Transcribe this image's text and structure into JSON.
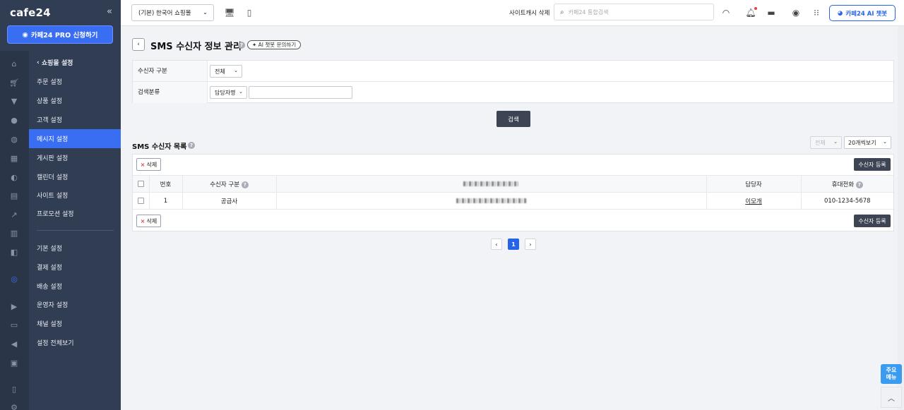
{
  "brand": {
    "logo": "cafe24",
    "collapse_icon": "«",
    "pro_button": "카페24 PRO 신청하기"
  },
  "sidebar": {
    "rail_icons": [
      "home-icon",
      "cart-icon",
      "shirt-icon",
      "person-icon",
      "chat-icon",
      "grid-icon",
      "palette-icon",
      "coupon-icon",
      "chart-icon",
      "calendar-icon",
      "app-icon",
      "medal-icon",
      "youtube-icon",
      "store-icon",
      "megaphone-icon",
      "shop-icon",
      "doc-icon",
      "settings-icon"
    ],
    "menu_head": "쇼핑몰 설정",
    "items": [
      "주문 설정",
      "상품 설정",
      "고객 설정",
      "메시지 설정",
      "게시판 설정",
      "캘린더 설정",
      "사이트 설정",
      "프로모션 설정"
    ],
    "items2": [
      "기본 설정",
      "결제 설정",
      "배송 설정",
      "운영자 설정",
      "채널 설정",
      "설정 전체보기"
    ]
  },
  "topbar": {
    "shop_select": "(기본) 한국어 쇼핑몰",
    "cache_label": "사이트캐시 삭제",
    "search_placeholder": "카페24 통합검색",
    "ai_chat": "카페24 AI 챗봇"
  },
  "page": {
    "title": "SMS 수신자 정보 관리",
    "ai_ask": "AI 챗봇 문의하기",
    "filter": {
      "recipient_type_label": "수신자 구분",
      "recipient_type_value": "전체",
      "search_category_label": "검색분류",
      "search_category_value": "담당자명",
      "search_text": ""
    },
    "search_button": "검색",
    "list_title": "SMS 수신자 목록",
    "select_all": "전체",
    "select_count": "20개씩보기",
    "delete_button": "삭제",
    "register_button": "수신자 등록",
    "table": {
      "headers": [
        "번호",
        "수신자 구분",
        "",
        "담당자",
        "휴대전화"
      ],
      "rows": [
        {
          "no": "1",
          "type": "공급사",
          "manager": "이모개",
          "phone": "010-1234-5678"
        }
      ]
    },
    "pagination": {
      "prev": "‹",
      "current": "1",
      "next": "›"
    }
  },
  "floating": {
    "quick_menu": "주요\n메뉴",
    "to_top": "︿"
  }
}
